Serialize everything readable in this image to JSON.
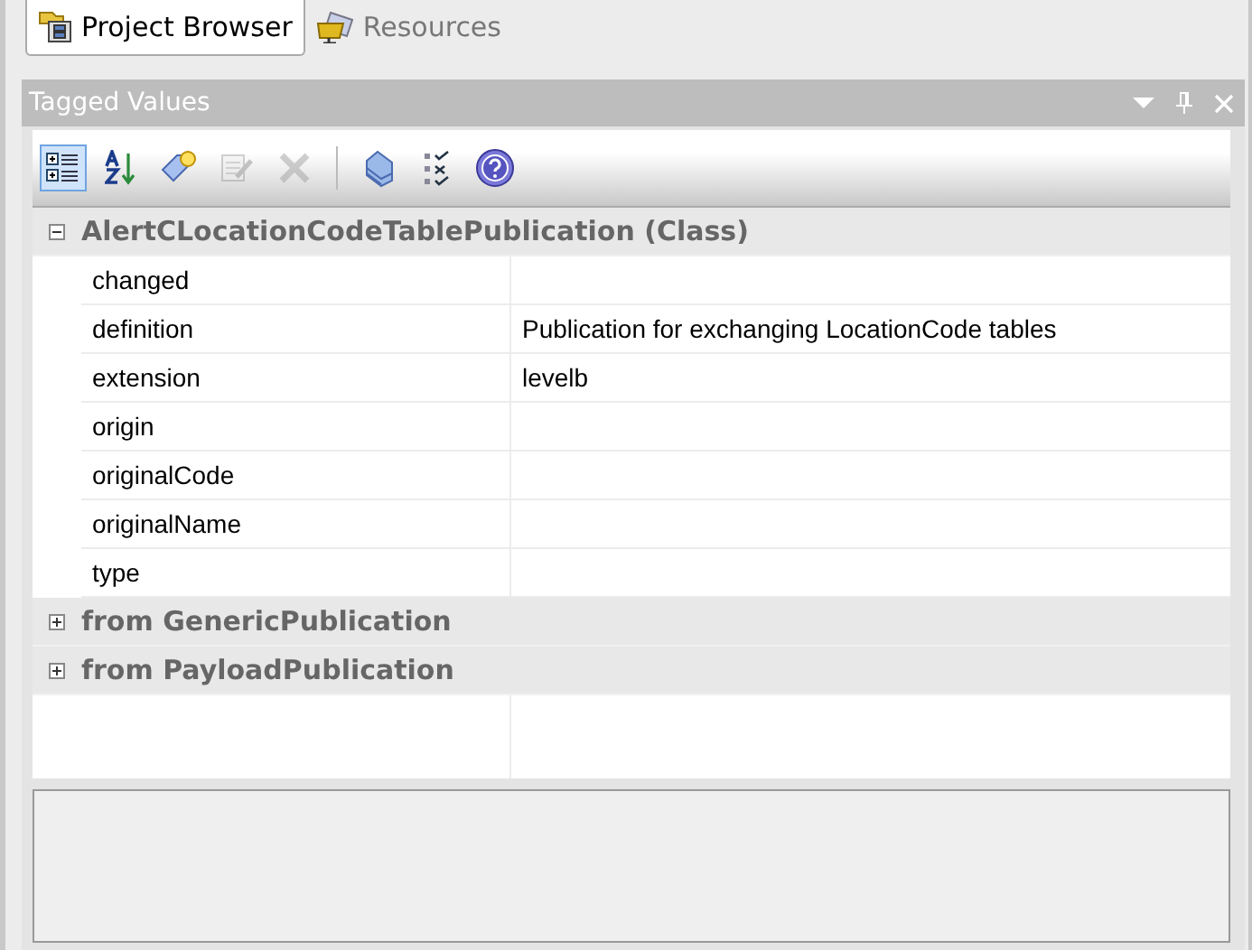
{
  "tabs": [
    {
      "label": "Project Browser",
      "kind": "browser",
      "selected": true
    },
    {
      "label": "Resources",
      "kind": "resources",
      "selected": false
    }
  ],
  "panel": {
    "title": "Tagged Values"
  },
  "toolbar": {
    "sections": [
      {
        "tools": [
          {
            "kind": "categorized",
            "selected": true,
            "disabled": false
          },
          {
            "kind": "sort",
            "selected": false,
            "disabled": false
          },
          {
            "kind": "new",
            "selected": false,
            "disabled": false
          },
          {
            "kind": "edit",
            "selected": false,
            "disabled": true
          },
          {
            "kind": "delete",
            "selected": false,
            "disabled": true
          }
        ]
      },
      {
        "tools": [
          {
            "kind": "tags",
            "selected": false,
            "disabled": false
          },
          {
            "kind": "checklist",
            "selected": false,
            "disabled": false
          },
          {
            "kind": "help",
            "selected": false,
            "disabled": false
          }
        ]
      }
    ]
  },
  "groups": [
    {
      "title": "AlertCLocationCodeTablePublication (Class)",
      "expanded": true,
      "properties": [
        {
          "name": "changed"
        },
        {
          "name": "definition",
          "value": "Publication for exchanging LocationCode tables"
        },
        {
          "name": "extension",
          "value": "levelb"
        },
        {
          "name": "origin"
        },
        {
          "name": "originalCode"
        },
        {
          "name": "originalName"
        },
        {
          "name": "type"
        }
      ]
    },
    {
      "title": "from GenericPublication",
      "expanded": false
    },
    {
      "title": "from PayloadPublication",
      "expanded": false
    }
  ]
}
